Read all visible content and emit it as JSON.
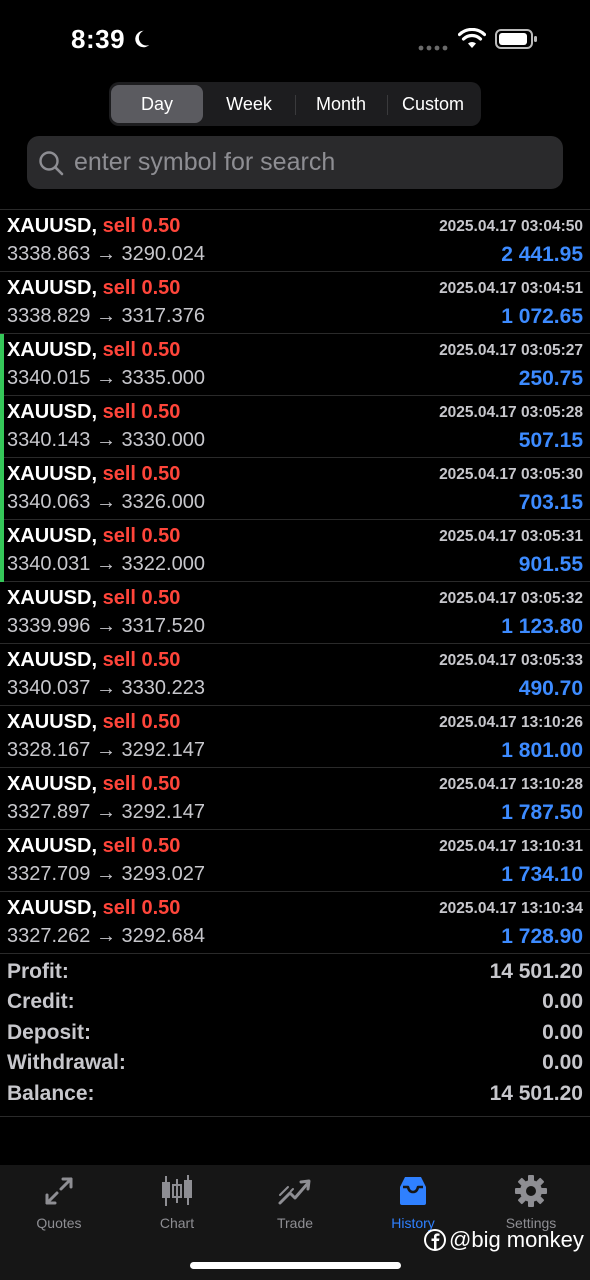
{
  "status_bar": {
    "time": "8:39"
  },
  "period_tabs": [
    {
      "label": "Day",
      "active": true
    },
    {
      "label": "Week",
      "active": false
    },
    {
      "label": "Month",
      "active": false
    },
    {
      "label": "Custom",
      "active": false
    }
  ],
  "search": {
    "placeholder": "enter symbol for search",
    "value": ""
  },
  "deals": [
    {
      "symbol": "XAUUSD,",
      "side": "sell 0.50",
      "open": "3338.863",
      "close": "3290.024",
      "time": "2025.04.17 03:04:50",
      "profit": "2 441.95",
      "marked": false
    },
    {
      "symbol": "XAUUSD,",
      "side": "sell 0.50",
      "open": "3338.829",
      "close": "3317.376",
      "time": "2025.04.17 03:04:51",
      "profit": "1 072.65",
      "marked": false
    },
    {
      "symbol": "XAUUSD,",
      "side": "sell 0.50",
      "open": "3340.015",
      "close": "3335.000",
      "time": "2025.04.17 03:05:27",
      "profit": "250.75",
      "marked": true
    },
    {
      "symbol": "XAUUSD,",
      "side": "sell 0.50",
      "open": "3340.143",
      "close": "3330.000",
      "time": "2025.04.17 03:05:28",
      "profit": "507.15",
      "marked": true
    },
    {
      "symbol": "XAUUSD,",
      "side": "sell 0.50",
      "open": "3340.063",
      "close": "3326.000",
      "time": "2025.04.17 03:05:30",
      "profit": "703.15",
      "marked": true
    },
    {
      "symbol": "XAUUSD,",
      "side": "sell 0.50",
      "open": "3340.031",
      "close": "3322.000",
      "time": "2025.04.17 03:05:31",
      "profit": "901.55",
      "marked": true
    },
    {
      "symbol": "XAUUSD,",
      "side": "sell 0.50",
      "open": "3339.996",
      "close": "3317.520",
      "time": "2025.04.17 03:05:32",
      "profit": "1 123.80",
      "marked": false
    },
    {
      "symbol": "XAUUSD,",
      "side": "sell 0.50",
      "open": "3340.037",
      "close": "3330.223",
      "time": "2025.04.17 03:05:33",
      "profit": "490.70",
      "marked": false
    },
    {
      "symbol": "XAUUSD,",
      "side": "sell 0.50",
      "open": "3328.167",
      "close": "3292.147",
      "time": "2025.04.17 13:10:26",
      "profit": "1 801.00",
      "marked": false
    },
    {
      "symbol": "XAUUSD,",
      "side": "sell 0.50",
      "open": "3327.897",
      "close": "3292.147",
      "time": "2025.04.17 13:10:28",
      "profit": "1 787.50",
      "marked": false
    },
    {
      "symbol": "XAUUSD,",
      "side": "sell 0.50",
      "open": "3327.709",
      "close": "3293.027",
      "time": "2025.04.17 13:10:31",
      "profit": "1 734.10",
      "marked": false
    },
    {
      "symbol": "XAUUSD,",
      "side": "sell 0.50",
      "open": "3327.262",
      "close": "3292.684",
      "time": "2025.04.17 13:10:34",
      "profit": "1 728.90",
      "marked": false
    }
  ],
  "arrow": "→",
  "summary": {
    "profit_label": "Profit:",
    "profit": "14 501.20",
    "credit_label": "Credit:",
    "credit": "0.00",
    "deposit_label": "Deposit:",
    "deposit": "0.00",
    "withdrawal_label": "Withdrawal:",
    "withdrawal": "0.00",
    "balance_label": "Balance:",
    "balance": "14 501.20"
  },
  "tabbar": [
    {
      "label": "Quotes",
      "icon": "quotes-icon",
      "active": false
    },
    {
      "label": "Chart",
      "icon": "chart-icon",
      "active": false
    },
    {
      "label": "Trade",
      "icon": "trade-icon",
      "active": false
    },
    {
      "label": "History",
      "icon": "history-icon",
      "active": true
    },
    {
      "label": "Settings",
      "icon": "gear-icon",
      "active": false
    }
  ],
  "watermark": "@big monkey",
  "colors": {
    "sell": "#ff453a",
    "profit": "#3d8bff",
    "active_tab": "#2f80ff",
    "marker": "#35c759"
  }
}
